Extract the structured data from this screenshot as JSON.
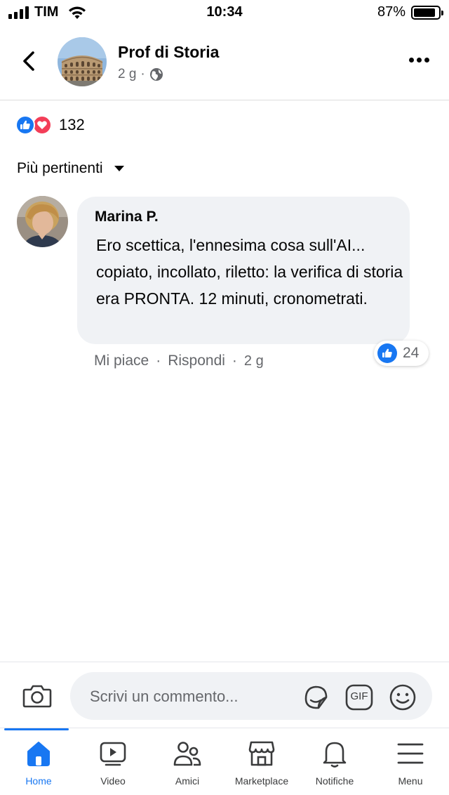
{
  "status_bar": {
    "carrier": "TIM",
    "time": "10:34",
    "battery_percent": "87%",
    "battery_level": 0.87
  },
  "post_header": {
    "page_name": "Prof di Storia",
    "time_ago": "2 g",
    "separator": "·",
    "audience_icon": "globe-icon",
    "back_icon": "chevron-left-icon",
    "more_icon": "more-horizontal-icon"
  },
  "reactions": {
    "types": [
      "like",
      "love"
    ],
    "count": "132",
    "colors": {
      "like": "#1877f2",
      "love": "#f33e58"
    }
  },
  "sort": {
    "label": "Più pertinenti"
  },
  "comments": [
    {
      "author": "Marina P.",
      "text": "Ero scettica, l'ennesima cosa sull'AI... copiato, incollato, riletto: la verifica di storia era PRONTA. 12 minuti, cronometrati.",
      "like_label": "Mi piace",
      "reply_label": "Rispondi",
      "separator": "·",
      "time_ago": "2 g",
      "reaction_count": "24"
    }
  ],
  "composer": {
    "placeholder": "Scrivi un commento...",
    "gif_label": "GIF",
    "icons": [
      "camera-icon",
      "sticker-icon",
      "gif-icon",
      "emoji-icon"
    ]
  },
  "tabs": [
    {
      "label": "Home",
      "icon": "home-icon",
      "active": true
    },
    {
      "label": "Video",
      "icon": "video-icon",
      "active": false
    },
    {
      "label": "Amici",
      "icon": "friends-icon",
      "active": false
    },
    {
      "label": "Marketplace",
      "icon": "marketplace-icon",
      "active": false
    },
    {
      "label": "Notifiche",
      "icon": "bell-icon",
      "active": false
    },
    {
      "label": "Menu",
      "icon": "menu-icon",
      "active": false
    }
  ],
  "colors": {
    "accent": "#1877f2",
    "text_primary": "#050505",
    "text_secondary": "#65676b",
    "bubble_bg": "#f0f2f5"
  }
}
